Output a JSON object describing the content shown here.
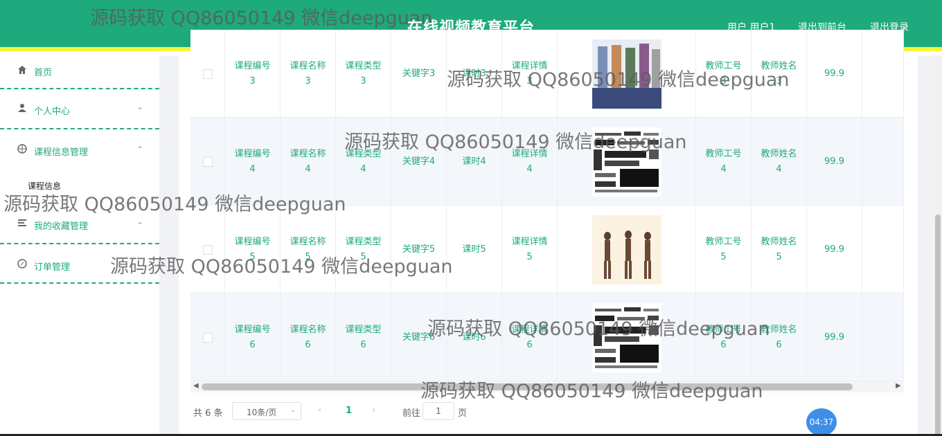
{
  "header": {
    "title": "在线视频教育平台",
    "user_label": "用户 用户1",
    "back_label": "退出到前台",
    "logout_label": "退出登录"
  },
  "sidebar": {
    "items": [
      {
        "label": "首页",
        "icon": "home-icon"
      },
      {
        "label": "个人中心",
        "icon": "user-icon"
      },
      {
        "label": "课程信息管理",
        "icon": "target-icon"
      },
      {
        "label": "我的收藏管理",
        "icon": "list-icon"
      },
      {
        "label": "订单管理",
        "icon": "compass-icon"
      }
    ],
    "sub_item": "课程信息"
  },
  "table": {
    "rows": [
      {
        "code": [
          "课程编号",
          "3"
        ],
        "name": [
          "课程名称",
          "3"
        ],
        "type": [
          "课程类型",
          "3"
        ],
        "keyword": "关键字3",
        "hours": "课时3",
        "detail": [
          "课程详情",
          "3"
        ],
        "image": "people",
        "teacher_id": [
          "教师工号",
          "3"
        ],
        "teacher_name": [
          "教师姓名",
          "3"
        ],
        "price": "99.9"
      },
      {
        "code": [
          "课程编号",
          "4"
        ],
        "name": [
          "课程名称",
          "4"
        ],
        "type": [
          "课程类型",
          "4"
        ],
        "keyword": "关键字4",
        "hours": "课时4",
        "detail": [
          "课程详情",
          "4"
        ],
        "image": "words",
        "teacher_id": [
          "教师工号",
          "4"
        ],
        "teacher_name": [
          "教师姓名",
          "4"
        ],
        "price": "99.9"
      },
      {
        "code": [
          "课程编号",
          "5"
        ],
        "name": [
          "课程名称",
          "5"
        ],
        "type": [
          "课程类型",
          "5"
        ],
        "keyword": "关键字5",
        "hours": "课时5",
        "detail": [
          "课程详情",
          "5"
        ],
        "image": "yoga",
        "teacher_id": [
          "教师工号",
          "5"
        ],
        "teacher_name": [
          "教师姓名",
          "5"
        ],
        "price": "99.9"
      },
      {
        "code": [
          "课程编号",
          "6"
        ],
        "name": [
          "课程名称",
          "6"
        ],
        "type": [
          "课程类型",
          "6"
        ],
        "keyword": "关键字6",
        "hours": "课时6",
        "detail": [
          "课程详情",
          "6"
        ],
        "image": "words",
        "teacher_id": [
          "教师工号",
          "6"
        ],
        "teacher_name": [
          "教师姓名",
          "6"
        ],
        "price": "99.9"
      }
    ]
  },
  "pagination": {
    "total": "共 6 条",
    "page_size": "10条/页",
    "current_page": "1",
    "goto_label": "前往",
    "goto_value": "1",
    "page_suffix": "页"
  },
  "timer": "04:37",
  "watermark": "源码获取 QQ86050149 微信deepguan",
  "colors": {
    "accent": "#1eaa7d",
    "header_border": "#f5f53c"
  }
}
